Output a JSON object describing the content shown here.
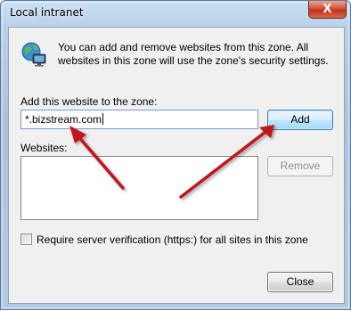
{
  "window": {
    "title": "Local intranet",
    "close_glyph": "X"
  },
  "info": {
    "icon": "globe-monitor-icon",
    "text": "You can add and remove websites from this zone. All websites in this zone will use the zone's security settings."
  },
  "add_section": {
    "label": "Add this website to the zone:",
    "input_value": "*.bizstream.com",
    "add_button": "Add"
  },
  "websites_section": {
    "label": "Websites:",
    "items": [],
    "remove_button": "Remove"
  },
  "verification": {
    "checked": false,
    "label": "Require server verification (https:) for all sites in this zone"
  },
  "footer": {
    "close_button": "Close"
  },
  "colors": {
    "annotation_arrow": "#c0181f",
    "add_button_border": "#3c7fb1",
    "dialog_bg": "#f0f0f0"
  }
}
